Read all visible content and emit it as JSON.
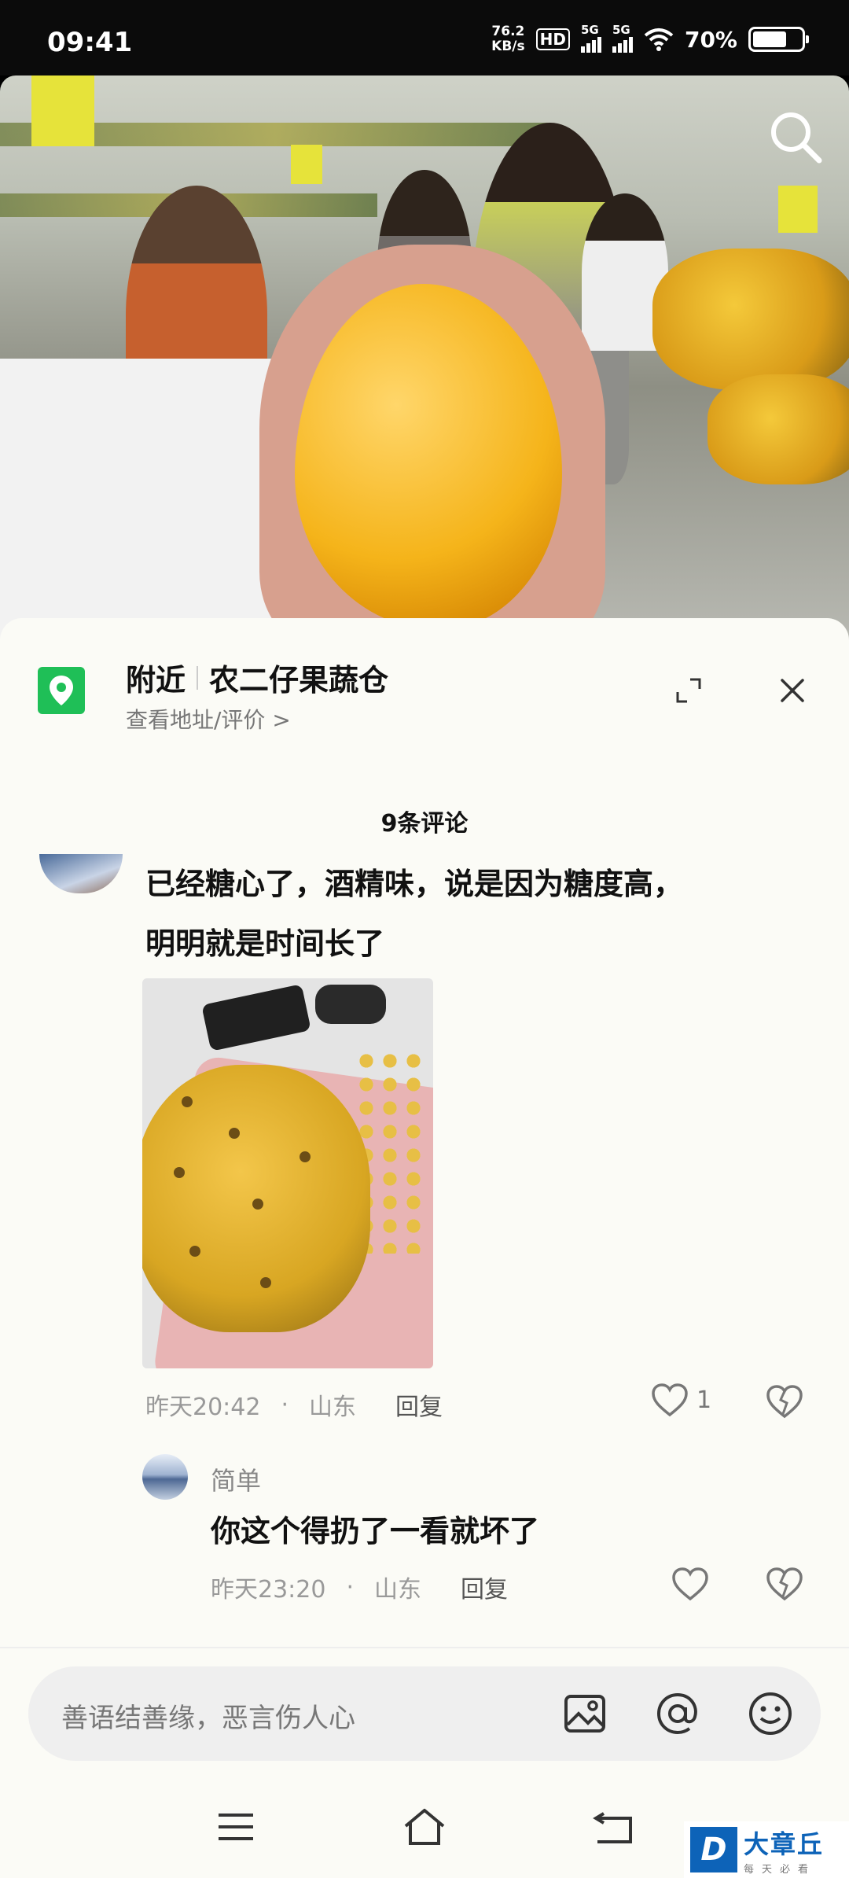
{
  "status_bar": {
    "time": "09:41",
    "net_speed_value": "76.2",
    "net_speed_unit": "KB/s",
    "hd_label": "HD",
    "signal1_label": "5G",
    "signal2_label": "5G",
    "battery_percent": "70%",
    "battery_level": 0.7
  },
  "video": {
    "search_icon": "search-icon"
  },
  "location": {
    "icon": "location-pin-icon",
    "nearby_label": "附近",
    "store_name": "农二仔果蔬仓",
    "sub_link": "查看地址/评价 >"
  },
  "comments": {
    "count_label": "9条评论",
    "main": {
      "text_line1": "已经糖心了，酒精味，说是因为糖度高，",
      "text_line2": "明明就是时间长了",
      "time": "昨天20:42",
      "dot": "·",
      "region": "山东",
      "reply_label": "回复",
      "like_count": "1"
    },
    "reply": {
      "username": "简单",
      "text": "你这个得扔了一看就坏了",
      "time": "昨天23:20",
      "dot": "·",
      "region": "山东",
      "reply_label": "回复"
    }
  },
  "input": {
    "placeholder": "善语结善缘，恶言伤人心",
    "icons": [
      "image-icon",
      "at-icon",
      "emoji-icon"
    ]
  },
  "nav": {
    "icons": [
      "menu-icon",
      "home-icon",
      "back-icon"
    ]
  },
  "watermark": {
    "logo_letter": "D",
    "brand": "大章丘",
    "tagline": "每天必看"
  },
  "colors": {
    "location_green": "#1fbf57",
    "watermark_blue": "#0d63b8",
    "sheet_bg": "#fbfbf6"
  }
}
